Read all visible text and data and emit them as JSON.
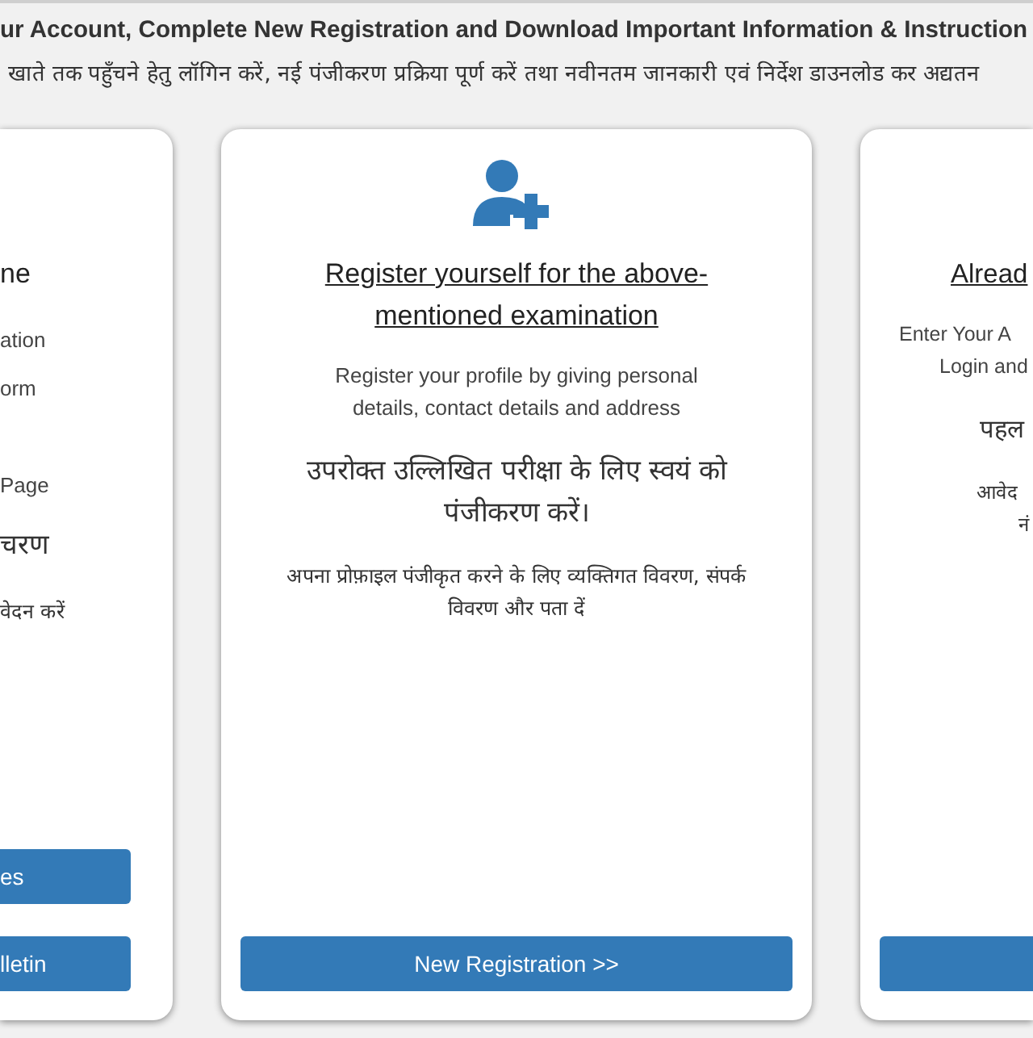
{
  "header": {
    "title": "ur Account, Complete New Registration and Download Important Information & Instruction",
    "subtitle": "खाते तक पहुँचने हेतु लॉगिन करें, नई पंजीकरण प्रक्रिया पूर्ण करें तथा नवीनतम जानकारी एवं निर्देश डाउनलोड कर अद्यतन"
  },
  "cards": [
    {
      "kind": "left",
      "heading": "ne",
      "lines": [
        {
          "kind": "en",
          "text": "ation"
        },
        {
          "kind": "en",
          "text": "orm"
        },
        {
          "kind": "en",
          "text": "Page"
        },
        {
          "kind": "hi-heading",
          "text": "चरण"
        },
        {
          "kind": "hi",
          "text": "वेदन करें"
        }
      ],
      "buttons": [
        {
          "kind": "labelled",
          "label": "es"
        },
        {
          "kind": "labelled",
          "label": "lletin"
        }
      ]
    },
    {
      "kind": "middle",
      "heading": "Register yourself for the above-mentioned examination",
      "lines": [
        {
          "kind": "en",
          "text": "Register your profile by giving personal details, contact details and address"
        },
        {
          "kind": "hi-heading",
          "text": "उपरोक्त उल्लिखित परीक्षा के लिए स्वयं को पंजीकरण करें।"
        },
        {
          "kind": "hi",
          "text": "अपना प्रोफ़ाइल पंजीकृत करने के लिए व्यक्तिगत विवरण, संपर्क विवरण और पता दें"
        }
      ],
      "buttons": [
        {
          "kind": "labelled",
          "label": "New Registration >>"
        }
      ]
    },
    {
      "kind": "right",
      "heading": "Alread",
      "lines": [
        {
          "kind": "en",
          "text": "Enter Your A"
        },
        {
          "kind": "en",
          "text": "Login and"
        },
        {
          "kind": "hi-heading",
          "text": "पहल"
        },
        {
          "kind": "hi",
          "text": "आवेद"
        },
        {
          "kind": "hi",
          "text": "नं"
        }
      ],
      "buttons": [
        {
          "kind": "blank"
        }
      ]
    }
  ]
}
